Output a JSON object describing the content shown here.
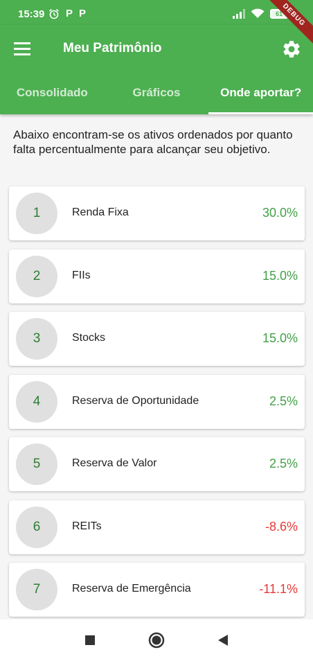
{
  "status_bar": {
    "time": "15:39",
    "notif_icons": [
      "P",
      "P"
    ],
    "battery": "61"
  },
  "debug_banner": "DEBUG",
  "app_bar": {
    "title": "Meu Patrimônio"
  },
  "tabs": [
    {
      "label": "Consolidado",
      "active": false
    },
    {
      "label": "Gráficos",
      "active": false
    },
    {
      "label": "Onde aportar?",
      "active": true
    }
  ],
  "intro_text": "Abaixo encontram-se os ativos ordenados por quanto falta percentualmente para alcançar seu objetivo.",
  "assets": [
    {
      "rank": "1",
      "name": "Renda Fixa",
      "pct": "30.0%"
    },
    {
      "rank": "2",
      "name": "FIIs",
      "pct": "15.0%"
    },
    {
      "rank": "3",
      "name": "Stocks",
      "pct": "15.0%"
    },
    {
      "rank": "4",
      "name": "Reserva de Oportunidade",
      "pct": "2.5%"
    },
    {
      "rank": "5",
      "name": "Reserva de Valor",
      "pct": "2.5%"
    },
    {
      "rank": "6",
      "name": "REITs",
      "pct": "-8.6%"
    },
    {
      "rank": "7",
      "name": "Reserva de Emergência",
      "pct": "-11.1%"
    }
  ],
  "colors": {
    "primary": "#4caf50",
    "positive": "#43a047",
    "negative": "#e53935",
    "rank_text": "#2e7d32"
  },
  "icons": {
    "menu": "menu-icon",
    "settings": "gear-icon",
    "nav_recents": "square-icon",
    "nav_home": "circle-icon",
    "nav_back": "triangle-back-icon"
  }
}
